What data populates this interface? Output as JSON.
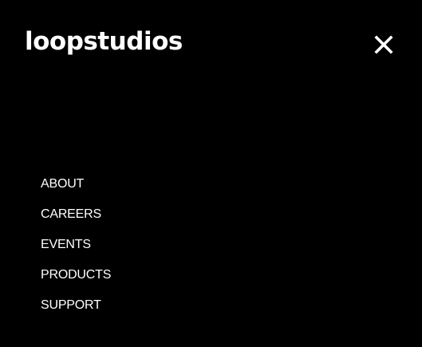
{
  "header": {
    "logo_text": "loopstudios",
    "close_icon": "close-icon"
  },
  "nav": {
    "items": [
      {
        "label": "ABOUT"
      },
      {
        "label": "CAREERS"
      },
      {
        "label": "EVENTS"
      },
      {
        "label": "PRODUCTS"
      },
      {
        "label": "SUPPORT"
      }
    ]
  },
  "colors": {
    "background": "#000000",
    "text": "#ffffff"
  }
}
